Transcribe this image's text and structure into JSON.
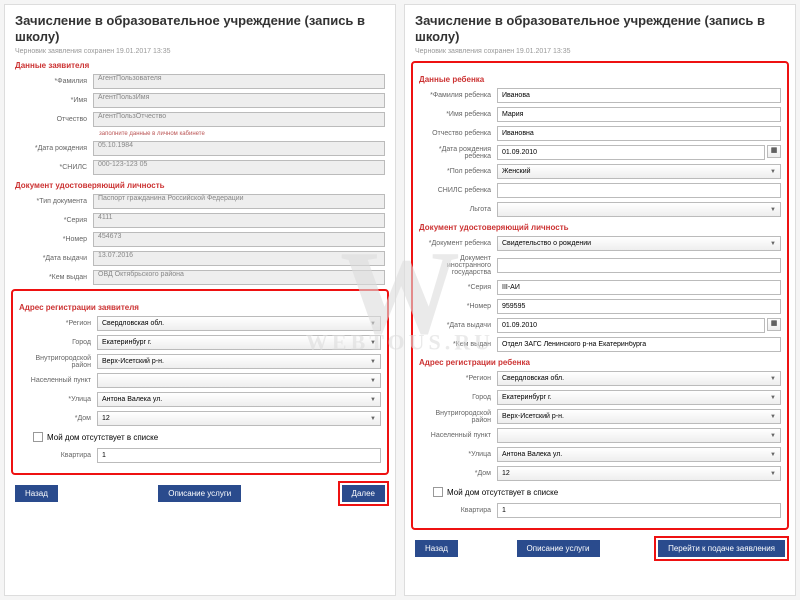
{
  "title": "Зачисление в образовательное учреждение (запись в школу)",
  "subtitle": "Черновик заявления сохранен 19.01.2017 13:35",
  "watermark": {
    "big": "W",
    "sub": "WEBTOUS.RU"
  },
  "left": {
    "sec1": "Данные заявителя",
    "r": {
      "fam_l": "*Фамилия",
      "fam_v": "АгентПользователя",
      "imya_l": "*Имя",
      "imya_v": "АгентПользИмя",
      "otch_l": "Отчество",
      "otch_v": "АгентПользОтчество",
      "otch_hint": "заполните данные в личном кабинете",
      "dr_l": "*Дата рождения",
      "dr_v": "05.10.1984",
      "snils_l": "*СНИЛС",
      "snils_v": "000-123-123 05"
    },
    "sec2": "Документ удостоверяющий личность",
    "d": {
      "tip_l": "*Тип документа",
      "tip_v": "Паспорт гражданина Российской Федерации",
      "ser_l": "*Серия",
      "ser_v": "4111",
      "num_l": "*Номер",
      "num_v": "454673",
      "dv_l": "*Дата выдачи",
      "dv_v": "13.07.2016",
      "kv_l": "*Кем выдан",
      "kv_v": "ОВД Октябрьского района"
    },
    "sec3": "Адрес регистрации заявителя",
    "a": {
      "reg_l": "*Регион",
      "reg_v": "Свердловская обл.",
      "gor_l": "Город",
      "gor_v": "Екатеринбург г.",
      "rai_l": "Внутригородской район",
      "rai_v": "Верх-Исетский р-н.",
      "np_l": "Населенный пункт",
      "np_v": "",
      "ul_l": "*Улица",
      "ul_v": "Антона Валека ул.",
      "dom_l": "*Дом",
      "dom_v": "12",
      "check": "Мой дом отсутствует в списке",
      "kv_l": "Квартира",
      "kv_v": "1"
    },
    "btn_back": "Назад",
    "btn_desc": "Описание услуги",
    "btn_next": "Далее"
  },
  "right": {
    "sec1": "Данные ребенка",
    "c": {
      "fam_l": "*Фамилия ребенка",
      "fam_v": "Иванова",
      "imya_l": "*Имя ребенка",
      "imya_v": "Мария",
      "otch_l": "Отчество ребенка",
      "otch_v": "Ивановна",
      "dr_l": "*Дата рождения ребенка",
      "dr_v": "01.09.2010",
      "pol_l": "*Пол ребенка",
      "pol_v": "Женский",
      "snils_l": "СНИЛС ребенка",
      "snils_v": "",
      "lg_l": "Льгота",
      "lg_v": ""
    },
    "sec2": "Документ удостоверяющий личность",
    "d": {
      "doc_l": "*Документ ребенка",
      "doc_v": "Свидетельство о рождении",
      "ig_l": "Документ иностранного государства",
      "ig_v": "",
      "ser_l": "*Серия",
      "ser_v": "III-АИ",
      "num_l": "*Номер",
      "num_v": "959595",
      "dv_l": "*Дата выдачи",
      "dv_v": "01.09.2010",
      "kv_l": "*Кем выдан",
      "kv_v": "Отдел ЗАГС Ленинского р-на Екатеринбурга"
    },
    "sec3": "Адрес регистрации ребенка",
    "a": {
      "reg_l": "*Регион",
      "reg_v": "Свердловская обл.",
      "gor_l": "Город",
      "gor_v": "Екатеринбург г.",
      "rai_l": "Внутригородской район",
      "rai_v": "Верх-Исетский р-н.",
      "np_l": "Населенный пункт",
      "np_v": "",
      "ul_l": "*Улица",
      "ul_v": "Антона Валека ул.",
      "dom_l": "*Дом",
      "dom_v": "12",
      "check": "Мой дом отсутствует в списке",
      "kv_l": "Квартира",
      "kv_v": "1"
    },
    "btn_back": "Назад",
    "btn_desc": "Описание услуги",
    "btn_submit": "Перейти к подаче заявления"
  }
}
